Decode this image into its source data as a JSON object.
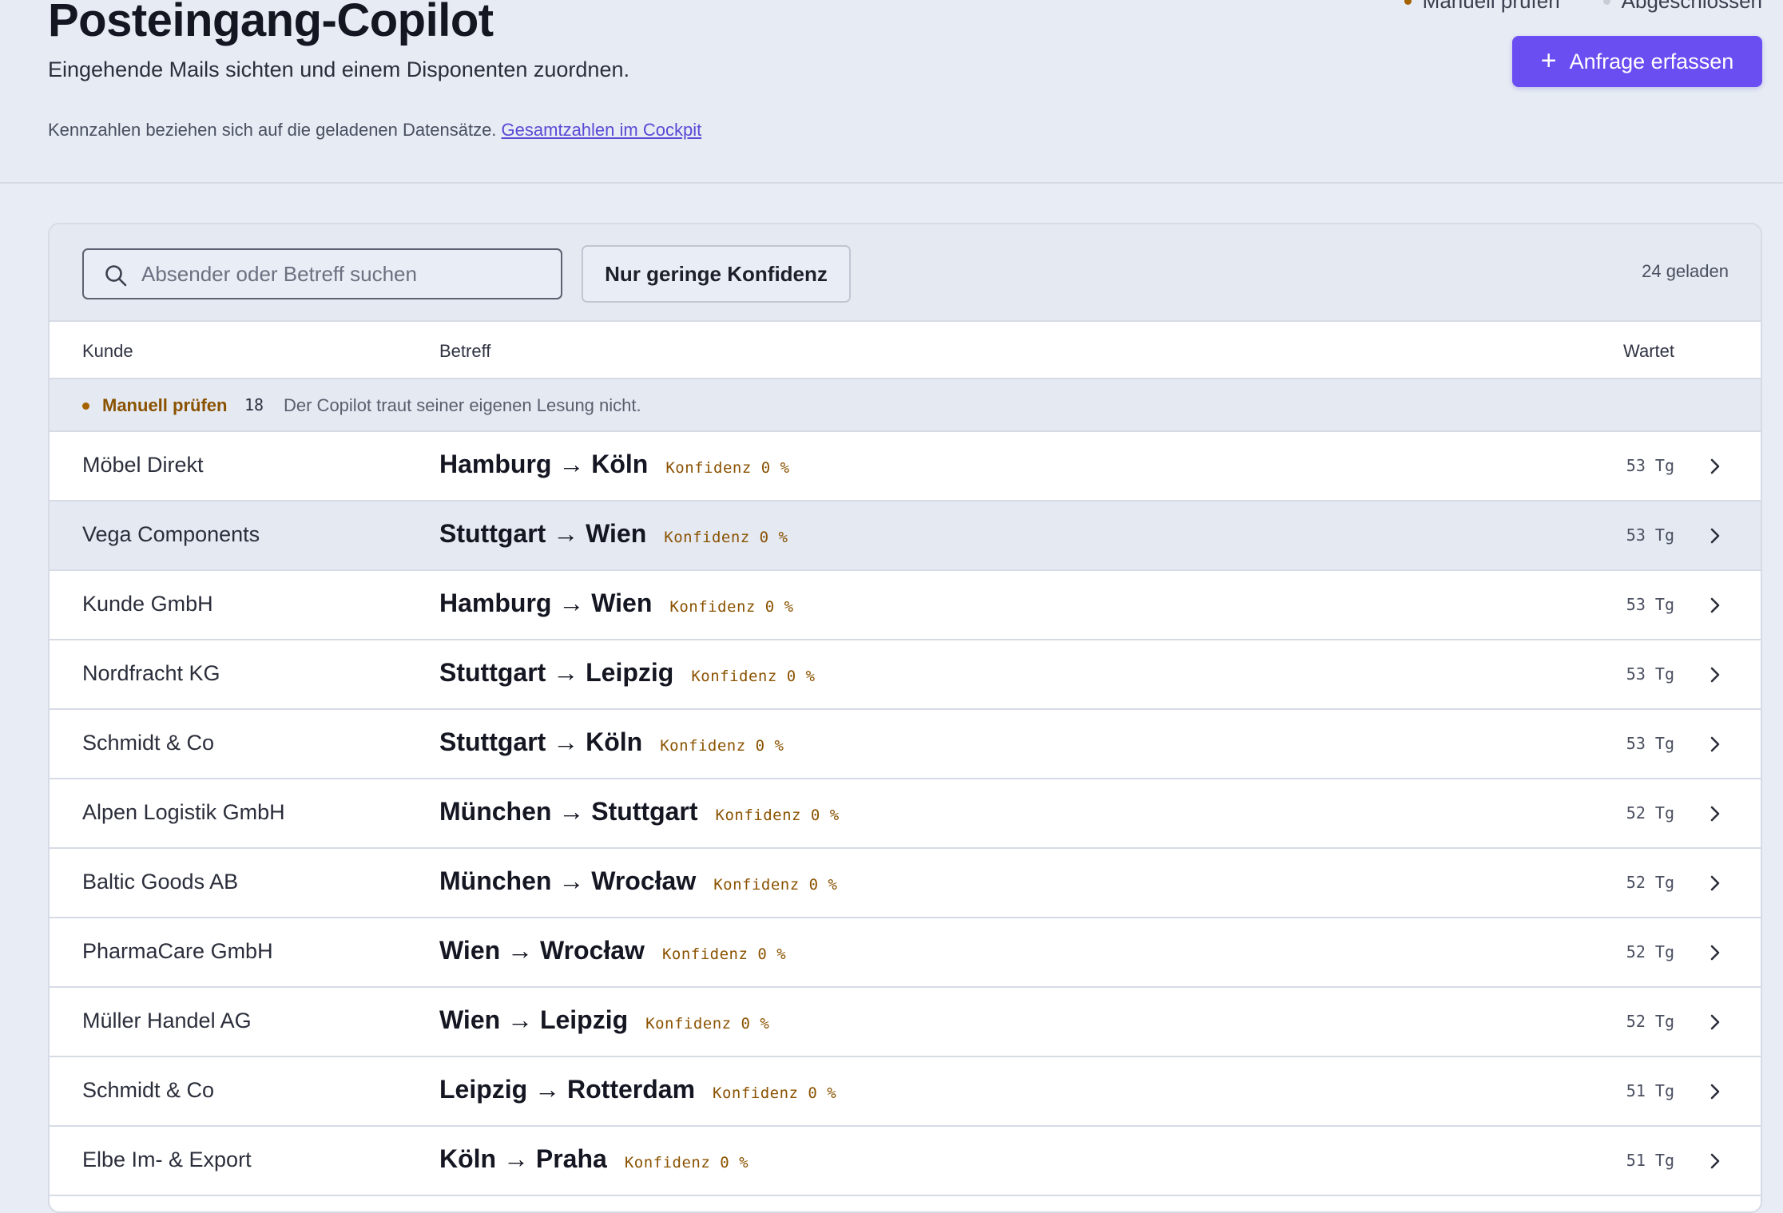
{
  "header": {
    "title": "Posteingang-Copilot",
    "subtitle": "Eingehende Mails sichten und einem Disponenten zuordnen.",
    "kpi_note": "Kennzahlen beziehen sich auf die geladenen Datensätze.",
    "kpi_link": "Gesamtzahlen im Cockpit",
    "legend": [
      {
        "label": "Manuell prüfen",
        "color": "#a56300"
      },
      {
        "label": "Abgeschlossen",
        "color": "#c8ccd6"
      }
    ],
    "primary_button": "Anfrage erfassen"
  },
  "toolbar": {
    "search_placeholder": "Absender oder Betreff suchen",
    "filter_label": "Nur geringe Konfidenz",
    "loaded_count": "24 geladen"
  },
  "columns": {
    "customer": "Kunde",
    "subject": "Betreff",
    "wait": "Wartet"
  },
  "group": {
    "label": "Manuell prüfen",
    "count": "18",
    "description": "Der Copilot traut seiner eigenen Lesung nicht."
  },
  "rows": [
    {
      "customer": "Möbel Direkt",
      "route": "Hamburg → Köln",
      "confidence": "Konfidenz 0 %",
      "wait": "53 Tg"
    },
    {
      "customer": "Vega Components",
      "route": "Stuttgart → Wien",
      "confidence": "Konfidenz 0 %",
      "wait": "53 Tg"
    },
    {
      "customer": "Kunde GmbH",
      "route": "Hamburg → Wien",
      "confidence": "Konfidenz 0 %",
      "wait": "53 Tg"
    },
    {
      "customer": "Nordfracht KG",
      "route": "Stuttgart → Leipzig",
      "confidence": "Konfidenz 0 %",
      "wait": "53 Tg"
    },
    {
      "customer": "Schmidt & Co",
      "route": "Stuttgart → Köln",
      "confidence": "Konfidenz 0 %",
      "wait": "53 Tg"
    },
    {
      "customer": "Alpen Logistik GmbH",
      "route": "München → Stuttgart",
      "confidence": "Konfidenz 0 %",
      "wait": "52 Tg"
    },
    {
      "customer": "Baltic Goods AB",
      "route": "München → Wrocław",
      "confidence": "Konfidenz 0 %",
      "wait": "52 Tg"
    },
    {
      "customer": "PharmaCare GmbH",
      "route": "Wien → Wrocław",
      "confidence": "Konfidenz 0 %",
      "wait": "52 Tg"
    },
    {
      "customer": "Müller Handel AG",
      "route": "Wien → Leipzig",
      "confidence": "Konfidenz 0 %",
      "wait": "52 Tg"
    },
    {
      "customer": "Schmidt & Co",
      "route": "Leipzig → Rotterdam",
      "confidence": "Konfidenz 0 %",
      "wait": "51 Tg"
    },
    {
      "customer": "Elbe Im- & Export",
      "route": "Köln → Praha",
      "confidence": "Konfidenz 0 %",
      "wait": "51 Tg"
    }
  ],
  "highlighted_row": 1
}
